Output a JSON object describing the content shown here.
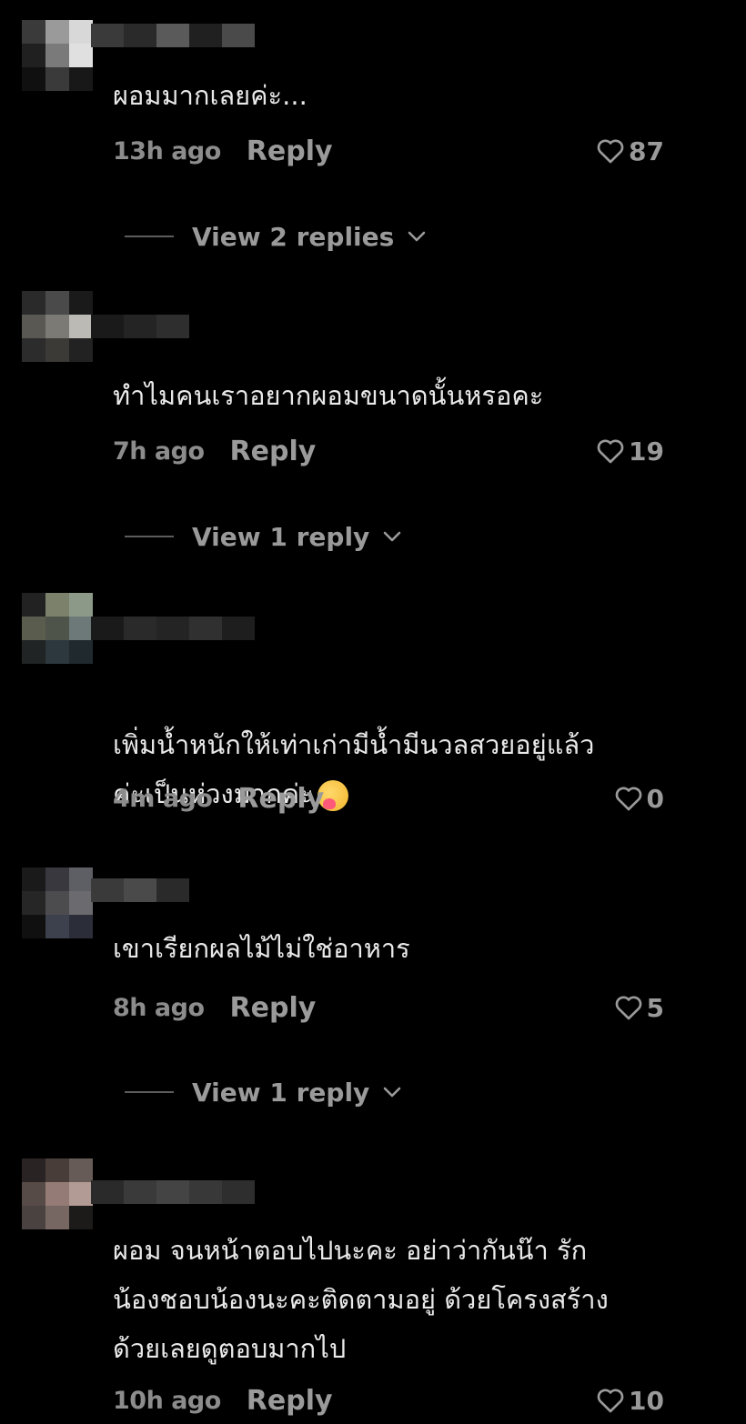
{
  "header": {
    "fragment": ""
  },
  "comments": [
    {
      "text": "ผอมมากเลยค่ะ...",
      "time": "13h ago",
      "reply_label": "Reply",
      "likes": "87",
      "view_replies": "View 2 replies",
      "avatar_colors": [
        "#3a3a3a",
        "#9a9a9a",
        "#d8d8d8",
        "#202020",
        "#7a7a7a",
        "#e0e0e0",
        "#101010",
        "#3a3a3a",
        "#181818"
      ],
      "name_colors": [
        "#3a3a3a",
        "#2a2a2a",
        "#5a5a5a",
        "#202020",
        "#4a4a4a"
      ]
    },
    {
      "text": "ทำไมคนเราอยากผอมขนาดนั้นหรอคะ",
      "time": "7h ago",
      "reply_label": "Reply",
      "likes": "19",
      "view_replies": "View 1 reply",
      "avatar_colors": [
        "#2a2a2a",
        "#4a4a4a",
        "#1a1a1a",
        "#5a5850",
        "#7c7a74",
        "#bcbab4",
        "#2c2c2c",
        "#3c3a36",
        "#222"
      ],
      "name_colors": [
        "#1a1a1a",
        "#242424",
        "#2e2e2e"
      ]
    },
    {
      "text": "เพิ่มน้ำหนักให้เท่าเก่ามีน้ำมีนวลสวยอยู่แล้ว\nค่ะเป็นห่วงมากค่ะ",
      "emoji": true,
      "time": "4m ago",
      "reply_label": "Reply",
      "likes": "0",
      "view_replies": "",
      "avatar_colors": [
        "#222",
        "#7a8266",
        "#8a9a86",
        "#5a5c4a",
        "#4e5448",
        "#6a7a78",
        "#202424",
        "#2a3840",
        "#1e2a30"
      ],
      "name_colors": [
        "#1a1a1a",
        "#2a2a2a",
        "#242424",
        "#303030",
        "#1e1e1e"
      ]
    },
    {
      "text": "เขาเรียกผลไม้ไม่ใช่อาหาร",
      "time": "8h ago",
      "reply_label": "Reply",
      "likes": "5",
      "view_replies": "View 1 reply",
      "avatar_colors": [
        "#1a1a1a",
        "#3a3840",
        "#5e5e66",
        "#262626",
        "#4c4c50",
        "#6a6a70",
        "#101010",
        "#3c4050",
        "#2a2e3a"
      ],
      "name_colors": [
        "#3a3a3a",
        "#4a4a4a",
        "#2a2a2a"
      ]
    },
    {
      "text": "ผอม จนหน้าตอบไปนะคะ อย่าว่ากันน๊า รัก\nน้องชอบน้องนะคะติดตามอยู่ ด้วยโครงสร้าง\nด้วยเลยดูตอบมากไป",
      "time": "10h ago",
      "reply_label": "Reply",
      "likes": "10",
      "view_replies": "",
      "avatar_colors": [
        "#2a2422",
        "#4a3c38",
        "#6a5a56",
        "#5a4a46",
        "#9a7a72",
        "#b89a92",
        "#4a4240",
        "#7a6660",
        "#1e1a1a"
      ],
      "name_colors": [
        "#2a2a2a",
        "#3a3a3a",
        "#444",
        "#383838",
        "#2e2e2e"
      ]
    }
  ]
}
